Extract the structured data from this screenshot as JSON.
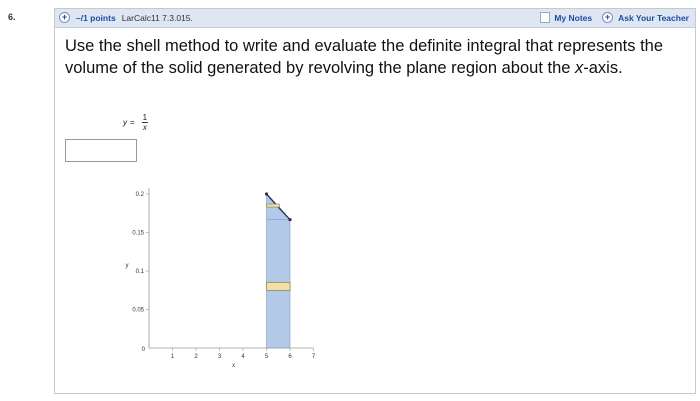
{
  "question_number": "6.",
  "header": {
    "points": "–/1 points",
    "assignment": "LarCalc11 7.3.015.",
    "my_notes": "My Notes",
    "ask_teacher": "Ask Your Teacher"
  },
  "question": {
    "text_part1": "Use the shell method to write and evaluate the definite integral that represents the volume of the solid generated by revolving the plane region about the ",
    "text_var": "x",
    "text_part2": "-axis."
  },
  "equation": {
    "lhs": "y",
    "eq": "=",
    "numerator": "1",
    "denominator": "x"
  },
  "answer": {
    "value": ""
  },
  "chart_data": {
    "type": "area",
    "function": "y = 1/x",
    "xlabel": "x",
    "ylabel": "y",
    "xlim": [
      0,
      7
    ],
    "ylim": [
      0,
      0.2
    ],
    "x_ticks": [
      "1",
      "2",
      "3",
      "4",
      "5",
      "6",
      "7"
    ],
    "y_ticks": [
      "0.2",
      "0.15",
      "0.1",
      "0.05"
    ],
    "origin_label": "0",
    "region": {
      "x_from": 5,
      "x_to": 6,
      "y_top": "1/x"
    },
    "curve_points": [
      [
        5,
        0.2
      ],
      [
        6,
        0.1667
      ]
    ],
    "shells_y": [
      0.185,
      0.08
    ],
    "colors": {
      "region": "#b3c9e8",
      "region_edge": "#7f9fcc",
      "shell": "#f3dfa8",
      "shell_edge": "#8a7a55",
      "curve": "#2f2f4f"
    }
  }
}
